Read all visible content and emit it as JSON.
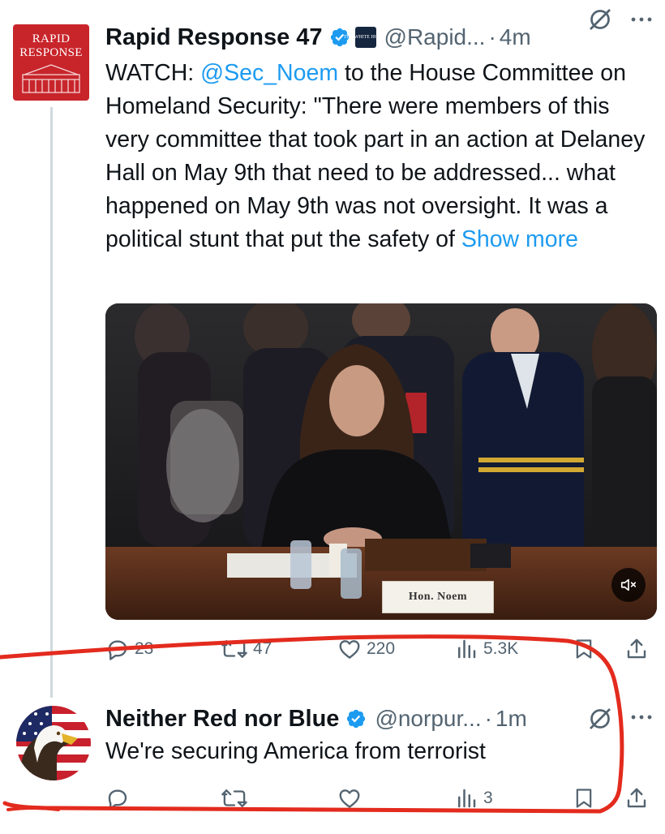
{
  "main_tweet": {
    "display_name": "Rapid Response 47",
    "handle": "@Rapid...",
    "separator": "·",
    "time": "4m",
    "affiliate_badge_text": "THE WHITE HOUSE",
    "avatar_text": "RAPID RESPONSE",
    "text_prefix": "WATCH: ",
    "mention": "@Sec_Noem",
    "text_body": " to the House Committee on Homeland Security: \"There were members of this very committee that took part in an action at Delaney Hall on May 9th that need to be addressed... what happened on May 9th was not oversight. It was a political stunt that put the safety of ",
    "show_more": "Show more",
    "media": {
      "nameplate": "Hon. Noem"
    },
    "actions": {
      "replies": "23",
      "reposts": "47",
      "likes": "220",
      "views": "5.3K"
    }
  },
  "reply_tweet": {
    "display_name": "Neither Red nor Blue",
    "handle": "@norpur...",
    "separator": "·",
    "time": "1m",
    "text": "We're securing America from terrorist",
    "actions": {
      "replies": "",
      "reposts": "",
      "likes": "",
      "views": "3"
    }
  },
  "colors": {
    "link": "#1d9bf0",
    "verified": "#1d9bf0",
    "muted": "#536471",
    "annotation_red": "#e32b1e",
    "thread_line": "#cfd9de"
  }
}
